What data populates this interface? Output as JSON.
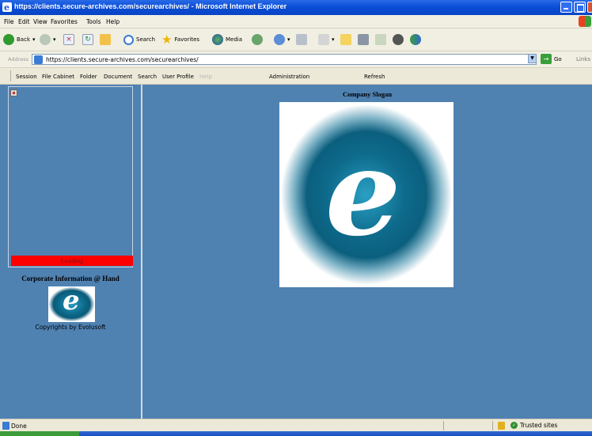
{
  "window": {
    "title": "https://clients.secure-archives.com/securearchives/ - Microsoft Internet Explorer"
  },
  "menubar": {
    "items": [
      "File",
      "Edit",
      "View",
      "Favorites",
      "Tools",
      "Help"
    ]
  },
  "toolbar": {
    "back": "Back",
    "search": "Search",
    "favorites": "Favorites",
    "media": "Media"
  },
  "address": {
    "label": "Address",
    "url": "https://clients.secure-archives.com/securearchives/",
    "go": "Go",
    "links": "Links"
  },
  "appmenu": {
    "items": [
      "Session",
      "File Cabinet",
      "Folder",
      "Document",
      "Search",
      "User Profile",
      "Help"
    ],
    "administration": "Administration",
    "refresh": "Refresh"
  },
  "sidebar": {
    "loading": "Loading",
    "corporate": "Corporate Information @ Hand",
    "logo_letter": "e",
    "copyright": "Copyrights by Evolusoft"
  },
  "main": {
    "slogan": "Company Slogan",
    "logo_letter": "e"
  },
  "statusbar": {
    "status": "Done",
    "zone": "Trusted sites"
  },
  "colors": {
    "content_bg": "#4f81b1",
    "loading_bar": "#ff0000",
    "logo_teal": "#0e6b8c",
    "titlebar": "#0a4fd8"
  }
}
